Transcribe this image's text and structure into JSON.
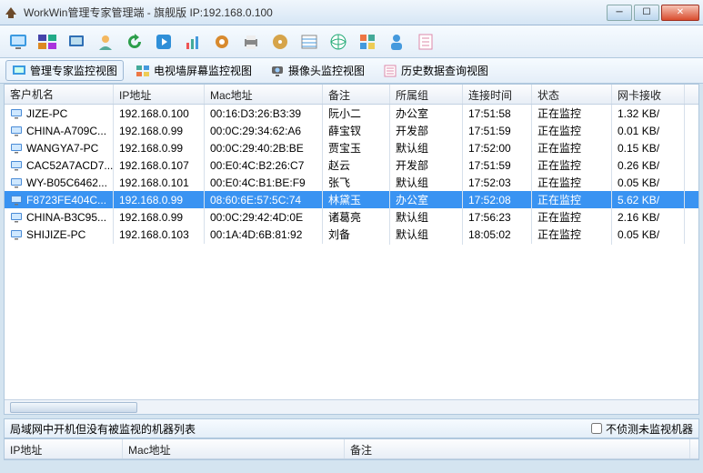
{
  "window": {
    "title": "WorkWin管理专家管理端 - 旗舰版 IP:192.168.0.100"
  },
  "tabs": [
    {
      "label": "管理专家监控视图"
    },
    {
      "label": "电视墙屏幕监控视图"
    },
    {
      "label": "摄像头监控视图"
    },
    {
      "label": "历史数据查询视图"
    }
  ],
  "columns": [
    "客户机名",
    "IP地址",
    "Mac地址",
    "备注",
    "所属组",
    "连接时间",
    "状态",
    "网卡接收"
  ],
  "rows": [
    {
      "name": "JIZE-PC",
      "ip": "192.168.0.100",
      "mac": "00:16:D3:26:B3:39",
      "note": "阮小二",
      "group": "办公室",
      "time": "17:51:58",
      "status": "正在监控",
      "net": "1.32 KB/",
      "selected": false
    },
    {
      "name": "CHINA-A709C...",
      "ip": "192.168.0.99",
      "mac": "00:0C:29:34:62:A6",
      "note": "薛宝钗",
      "group": "开发部",
      "time": "17:51:59",
      "status": "正在监控",
      "net": "0.01 KB/",
      "selected": false
    },
    {
      "name": "WANGYA7-PC",
      "ip": "192.168.0.99",
      "mac": "00:0C:29:40:2B:BE",
      "note": "贾宝玉",
      "group": "默认组",
      "time": "17:52:00",
      "status": "正在监控",
      "net": "0.15 KB/",
      "selected": false
    },
    {
      "name": "CAC52A7ACD7...",
      "ip": "192.168.0.107",
      "mac": "00:E0:4C:B2:26:C7",
      "note": "赵云",
      "group": "开发部",
      "time": "17:51:59",
      "status": "正在监控",
      "net": "0.26 KB/",
      "selected": false
    },
    {
      "name": "WY-B05C6462...",
      "ip": "192.168.0.101",
      "mac": "00:E0:4C:B1:BE:F9",
      "note": "张飞",
      "group": "默认组",
      "time": "17:52:03",
      "status": "正在监控",
      "net": "0.05 KB/",
      "selected": false
    },
    {
      "name": "F8723FE404C...",
      "ip": "192.168.0.99",
      "mac": "08:60:6E:57:5C:74",
      "note": "林黛玉",
      "group": "办公室",
      "time": "17:52:08",
      "status": "正在监控",
      "net": "5.62 KB/",
      "selected": true
    },
    {
      "name": "CHINA-B3C95...",
      "ip": "192.168.0.99",
      "mac": "00:0C:29:42:4D:0E",
      "note": "诸葛亮",
      "group": "默认组",
      "time": "17:56:23",
      "status": "正在监控",
      "net": "2.16 KB/",
      "selected": false
    },
    {
      "name": "SHIJIZE-PC",
      "ip": "192.168.0.103",
      "mac": "00:1A:4D:6B:81:92",
      "note": "刘备",
      "group": "默认组",
      "time": "18:05:02",
      "status": "正在监控",
      "net": "0.05 KB/",
      "selected": false
    }
  ],
  "bottom": {
    "title": "局域网中开机但没有被监视的机器列表",
    "checkbox": "不侦测未监视机器",
    "columns": [
      "IP地址",
      "Mac地址",
      "备注"
    ]
  },
  "icons": {
    "toolbar": [
      "monitor",
      "screens",
      "single-screen",
      "user",
      "refresh",
      "play",
      "chart",
      "settings",
      "print",
      "disk",
      "list",
      "globe",
      "apps",
      "person",
      "note"
    ]
  }
}
